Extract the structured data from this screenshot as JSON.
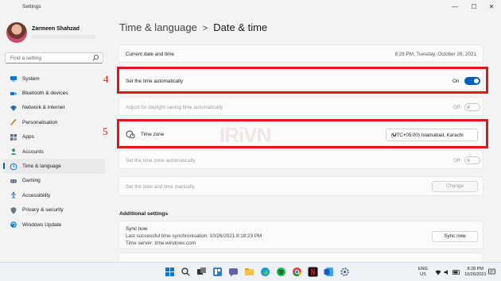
{
  "window": {
    "title": "Settings",
    "min_glyph": "—",
    "max_glyph": "☐",
    "close_glyph": "✕"
  },
  "user": {
    "name": "Zarmeen Shahzad"
  },
  "search": {
    "placeholder": "Find a setting"
  },
  "nav": [
    {
      "label": "System",
      "icon": "monitor-icon",
      "color": "#0078d4"
    },
    {
      "label": "Bluetooth & devices",
      "icon": "bluetooth-icon",
      "color": "#0078d4"
    },
    {
      "label": "Network & internet",
      "icon": "wifi-icon",
      "color": "#2b6cb0"
    },
    {
      "label": "Personalisation",
      "icon": "brush-icon",
      "color": "#c47a2c"
    },
    {
      "label": "Apps",
      "icon": "apps-icon",
      "color": "#5a6b85"
    },
    {
      "label": "Accounts",
      "icon": "person-icon",
      "color": "#2f9e6a"
    },
    {
      "label": "Time & language",
      "icon": "globe-clock-icon",
      "color": "#0078d4",
      "active": true
    },
    {
      "label": "Gaming",
      "icon": "gamepad-icon",
      "color": "#5a6b85"
    },
    {
      "label": "Accessibility",
      "icon": "accessibility-icon",
      "color": "#1e6fd0"
    },
    {
      "label": "Privacy & security",
      "icon": "shield-icon",
      "color": "#6b7785"
    },
    {
      "label": "Windows Update",
      "icon": "update-icon",
      "color": "#0078d4"
    }
  ],
  "breadcrumb": {
    "parent": "Time & language",
    "separator": ">",
    "current": "Date & time"
  },
  "current_time": {
    "label": "Current date and time",
    "value": "8:28 PM, Tuesday, October 26, 2021"
  },
  "set_time_auto": {
    "label": "Set the time automatically",
    "state": "On"
  },
  "dst_auto": {
    "label": "Adjust for daylight saving time automatically",
    "state": "Off"
  },
  "time_zone": {
    "label": "Time zone",
    "value": "(UTC+05:00) Islamabad, Karachi"
  },
  "tz_auto": {
    "label": "Set the time zone automatically",
    "state": "Off"
  },
  "manual": {
    "label": "Set the date and time manually",
    "button": "Change"
  },
  "additional": {
    "title": "Additional settings",
    "sync_title": "Sync now",
    "sync_last": "Last successful time synchronisation: 10/26/2021 8:18:23 PM",
    "sync_server": "Time server: time.windows.com",
    "sync_button": "Sync now"
  },
  "annotations": {
    "num4": "4",
    "num5": "5",
    "color": "#d91a1a"
  },
  "taskbar": {
    "lang_1": "ENG",
    "lang_2": "US",
    "time": "8:28 PM",
    "date": "10/26/2021",
    "icons": [
      "windows-start-icon",
      "search-icon",
      "task-view-icon",
      "widgets-icon",
      "chat-icon",
      "file-explorer-icon",
      "edge-icon",
      "spotify-icon",
      "chrome-icon",
      "netflix-icon",
      "word-icon",
      "settings-icon"
    ]
  },
  "colors": {
    "accent": "#005fb8",
    "background": "#f3f3f3",
    "card": "#fbfbfb"
  }
}
